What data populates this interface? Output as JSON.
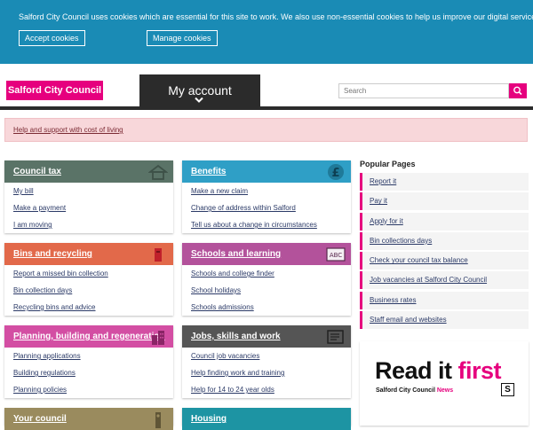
{
  "cookie": {
    "message": "Salford City Council uses cookies which are essential for this site to work. We also use non-essential cookies to help us improve our digital services.",
    "accept_label": "Accept cookies",
    "manage_label": "Manage cookies"
  },
  "header": {
    "logo_text": "Salford City Council",
    "my_account_label": "My account",
    "search_placeholder": "Search"
  },
  "alert": {
    "link_text": "Help and support with cost of living"
  },
  "cards": [
    {
      "title": "Council tax",
      "color": "#5a7367",
      "icon": "house-icon",
      "links": [
        "My bill",
        "Make a payment",
        "I am moving"
      ]
    },
    {
      "title": "Benefits",
      "color": "#2f9fc6",
      "icon": "pound-icon",
      "links": [
        "Make a new claim",
        "Change of address within Salford",
        "Tell us about a change in circumstances"
      ]
    },
    {
      "title": "Bins and recycling",
      "color": "#e2694a",
      "icon": "bin-icon",
      "links": [
        "Report a missed bin collection",
        "Bin collection days",
        "Recycling bins and advice"
      ]
    },
    {
      "title": "Schools and learning",
      "color": "#b3529b",
      "icon": "chalkboard-icon",
      "links": [
        "Schools and college finder",
        "School holidays",
        "Schools admissions"
      ]
    },
    {
      "title": "Planning, building and regeneration",
      "color": "#d34ea3",
      "icon": "buildings-icon",
      "links": [
        "Planning applications",
        "Building regulations",
        "Planning policies"
      ]
    },
    {
      "title": "Jobs, skills and work",
      "color": "#555555",
      "icon": "newspaper-icon",
      "links": [
        "Council job vacancies",
        "Help finding work and training",
        "Help for 14 to 24 year olds"
      ]
    },
    {
      "title": "Your council",
      "color": "#9a8b5e",
      "icon": "tower-icon",
      "links": []
    },
    {
      "title": "Housing",
      "color": "#1d94a3",
      "icon": "home-icon",
      "links": []
    }
  ],
  "popular": {
    "title": "Popular Pages",
    "items": [
      "Report it",
      "Pay it",
      "Apply for it",
      "Bin collections days",
      "Check your council tax balance",
      "Job vacancies at Salford City Council",
      "Business rates",
      "Staff email and websites"
    ]
  },
  "promo": {
    "headline_part1": "Read it ",
    "headline_part2": "first",
    "brand_part1": "Salford City Council ",
    "brand_part2": "News",
    "logo_letter": "S"
  },
  "colors": {
    "brand_pink": "#e6007e",
    "cookie_blue": "#1a8bb5",
    "dark": "#2b2b2b"
  }
}
